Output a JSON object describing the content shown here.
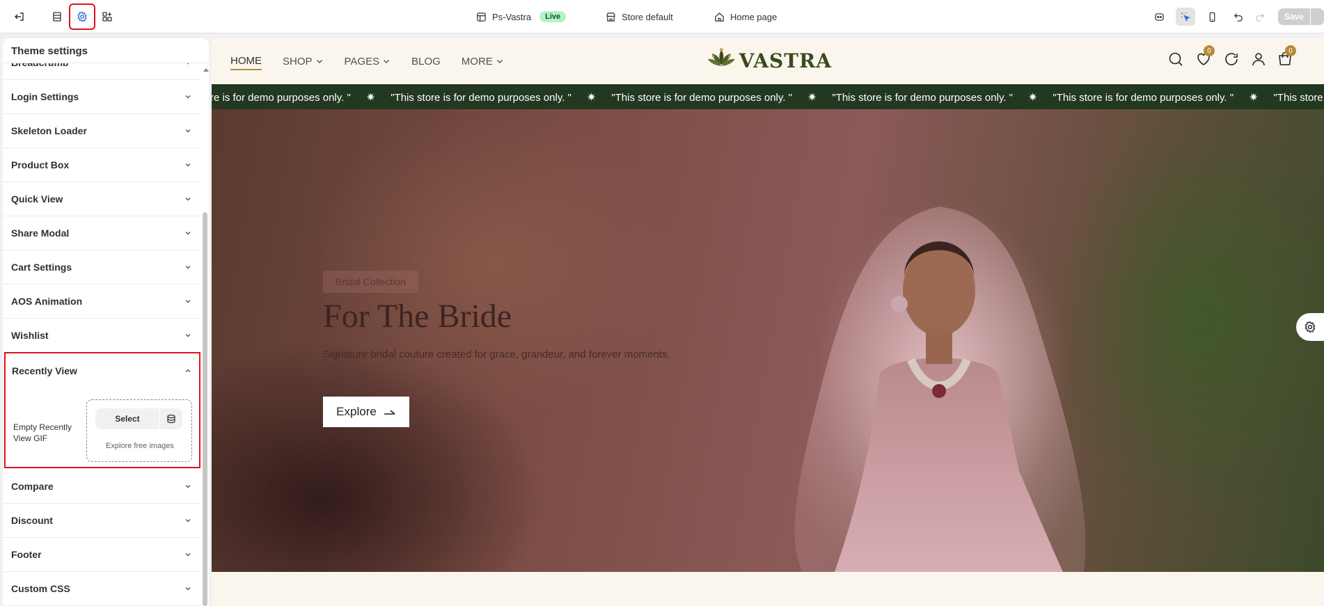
{
  "topbar": {
    "store_name": "Ps-Vastra",
    "status_badge": "Live",
    "theme_label": "Store default",
    "page_label": "Home page",
    "save_label": "Save"
  },
  "panel": {
    "title": "Theme settings",
    "partial_item": "Breadcrumb",
    "items": [
      "Login Settings",
      "Skeleton Loader",
      "Product Box",
      "Quick View",
      "Share Modal",
      "Cart Settings",
      "AOS Animation",
      "Wishlist",
      "Recently View",
      "Compare",
      "Discount",
      "Footer",
      "Custom CSS"
    ],
    "recently_view": {
      "field_label": "Empty Recently View GIF",
      "select_label": "Select",
      "explore_link": "Explore free images"
    }
  },
  "store": {
    "nav": [
      "HOME",
      "SHOP",
      "PAGES",
      "BLOG",
      "MORE"
    ],
    "logo_text": "VASTRA",
    "wishlist_count": "0",
    "cart_count": "0",
    "announcement": "\"This store is for demo purposes only. \"",
    "announcement_partial": "re is for demo purposes only. \"",
    "announcement_tail": "\"This store is",
    "hero": {
      "tag": "Bridal Collection",
      "title": "For The Bride",
      "subtitle": "Signature bridal couture created for grace, grandeur, and forever moments.",
      "button_label": "Explore"
    }
  },
  "colors": {
    "highlight": "#e0101e",
    "announcement_bg": "#233821",
    "accent_gold": "#b58b3b",
    "live_badge": "#b4f1c4"
  }
}
